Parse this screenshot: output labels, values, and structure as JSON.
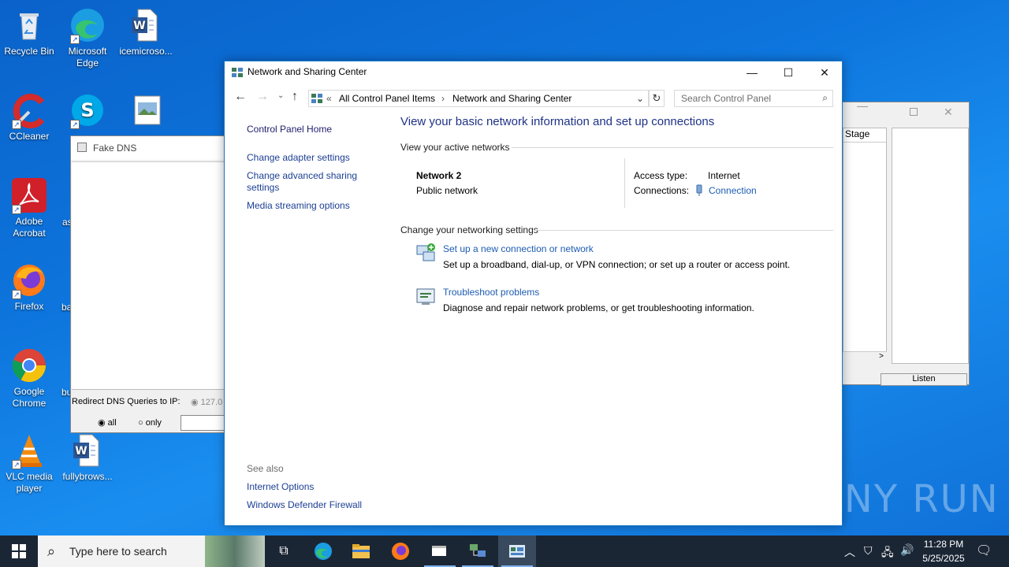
{
  "desktop": {
    "icons": [
      {
        "label": "Recycle Bin"
      },
      {
        "label": "Microsoft Edge"
      },
      {
        "label": "icemicroso..."
      },
      {
        "label": "CCleaner"
      },
      {
        "label": "Skype"
      },
      {
        "label": "Adobe Acrobat"
      },
      {
        "label": "Firefox"
      },
      {
        "label": "Google Chrome"
      },
      {
        "label": "VLC media player"
      },
      {
        "label": "fullybrows..."
      }
    ],
    "partial_labels": [
      "as",
      "ba",
      "bu"
    ]
  },
  "fake_dns": {
    "title": "Fake DNS",
    "redirect_label": "Redirect DNS Queries to IP:",
    "ip_value": "127.0",
    "radio_all": "all",
    "radio_only": "only"
  },
  "right_window": {
    "column_header": "Stage",
    "button_label": "Listen"
  },
  "window": {
    "title": "Network and Sharing Center",
    "breadcrumb_sep": "«",
    "breadcrumb": [
      "All Control Panel Items",
      "Network and Sharing Center"
    ],
    "search_placeholder": "Search Control Panel",
    "sidebar": {
      "home": "Control Panel Home",
      "links": [
        "Change adapter settings",
        "Change advanced sharing settings",
        "Media streaming options"
      ],
      "see_also_label": "See also",
      "see_also": [
        "Internet Options",
        "Windows Defender Firewall"
      ]
    },
    "heading": "View your basic network information and set up connections",
    "active_networks_label": "View your active networks",
    "network": {
      "name": "Network 2",
      "type": "Public network",
      "access_type_label": "Access type:",
      "access_type_value": "Internet",
      "connections_label": "Connections:",
      "connections_value": "Connection"
    },
    "change_settings_label": "Change your networking settings",
    "tasks": [
      {
        "title": "Set up a new connection or network",
        "desc": "Set up a broadband, dial-up, or VPN connection; or set up a router or access point."
      },
      {
        "title": "Troubleshoot problems",
        "desc": "Diagnose and repair network problems, or get troubleshooting information."
      }
    ]
  },
  "taskbar": {
    "search_placeholder": "Type here to search",
    "time": "11:28 PM",
    "date": "5/25/2025"
  },
  "watermark": "ANY RUN",
  "colors": {
    "accent": "#1979ca",
    "link": "#1c3f94",
    "heading": "#1e3287"
  }
}
